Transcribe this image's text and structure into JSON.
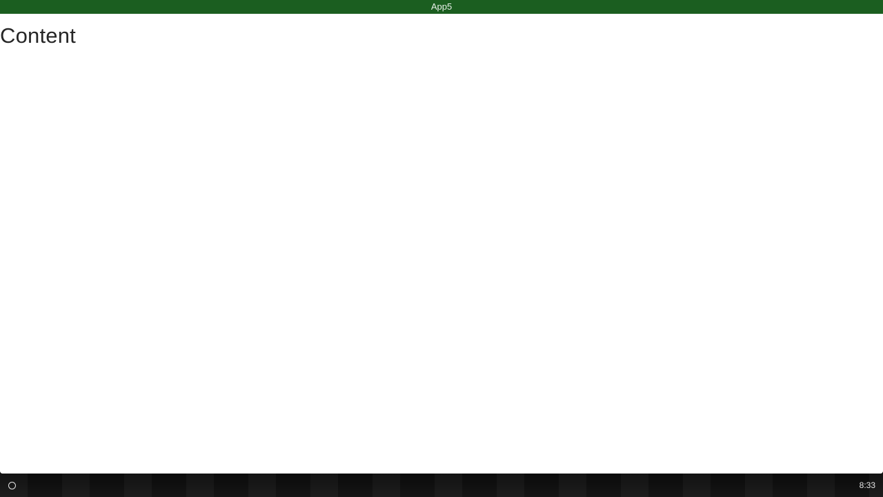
{
  "window": {
    "title": "App5",
    "titlebar_color": "#1b5e20"
  },
  "content": {
    "heading": "Content"
  },
  "shelf": {
    "launcher_icon": "circle-launcher-icon",
    "clock_time": "8:33"
  }
}
